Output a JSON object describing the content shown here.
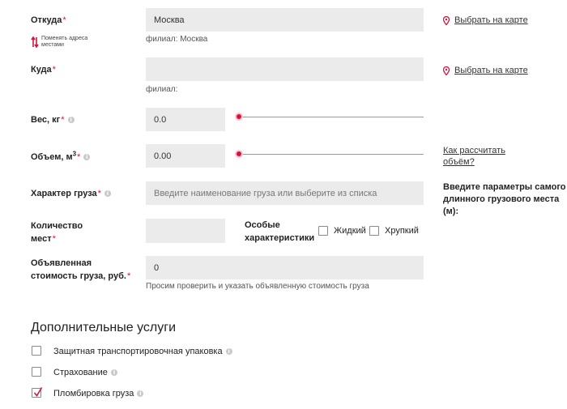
{
  "from": {
    "label": "Откуда",
    "value": "Москва",
    "branch": "филиал: Москва",
    "map_link": "Выбрать на карте",
    "swap_label": "Поменять адреса местами"
  },
  "to": {
    "label": "Куда",
    "value": "",
    "branch": "филиал:",
    "map_link": "Выбрать на карте"
  },
  "weight": {
    "label": "Вес, кг",
    "value": "0.0",
    "slider_level": 0
  },
  "volume": {
    "label": "Объем, м",
    "unit_sup": "3",
    "value": "0.00",
    "slider_level": 0,
    "calc_link": "Как рассчитать объём?"
  },
  "cargo_type": {
    "label": "Характер груза",
    "placeholder": "Введите наименование груза или выберите из списка"
  },
  "longest_place": {
    "label": "Введите параметры самого длинного грузового места (м):"
  },
  "places": {
    "label": "Количество мест",
    "value": ""
  },
  "special": {
    "label": "Особые характеристики",
    "options": [
      {
        "label": "Жидкий",
        "checked": false
      },
      {
        "label": "Хрупкий",
        "checked": false
      }
    ]
  },
  "declared_value": {
    "label": "Объявленная стоимость груза, руб.",
    "value": "0",
    "hint": "Просим проверить и указать объявленную стоимость груза"
  },
  "additional": {
    "title": "Дополнительные услуги",
    "items": [
      {
        "label": "Защитная транспортировочная упаковка",
        "checked": false
      },
      {
        "label": "Страхование",
        "checked": false
      },
      {
        "label": "Пломбировка груза",
        "checked": true
      }
    ]
  },
  "colors": {
    "accent": "#d4143c",
    "field_bg": "#ebebeb"
  },
  "icons": {
    "map_pin": "map-pin-icon",
    "swap": "swap-arrows-icon",
    "info": "info-icon",
    "check": "check-icon"
  }
}
